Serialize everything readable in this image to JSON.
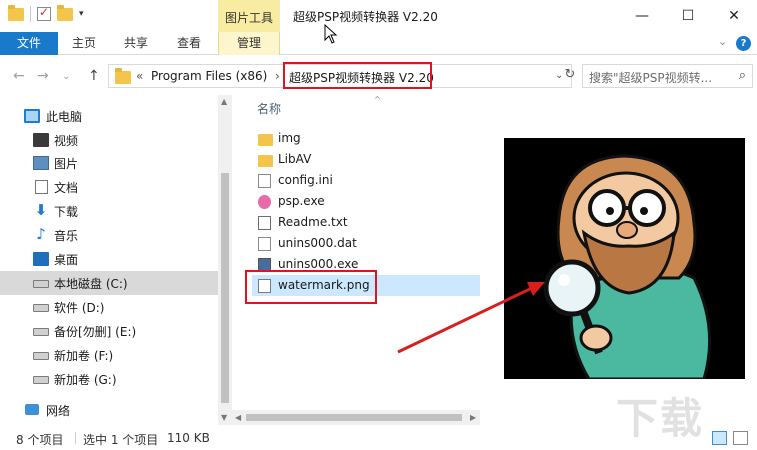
{
  "title_bar": {
    "context_tab": "图片工具",
    "window_title": "超级PSP视频转换器 V2.20",
    "minimize": "—",
    "maximize": "☐",
    "close": "✕"
  },
  "ribbon": {
    "file": "文件",
    "tabs": [
      "主页",
      "共享",
      "查看",
      "管理"
    ],
    "collapse_caret": "⌄",
    "help": "?"
  },
  "address": {
    "prefix": "«",
    "crumbs": [
      "Program Files (x86)",
      "超级PSP视频转换器 V2.20"
    ],
    "separator": "›",
    "dropdown": "⌄",
    "refresh": "↻",
    "search_placeholder": "搜索\"超级PSP视频转...",
    "back": "←",
    "forward": "→",
    "recent": "⌄",
    "up": "↑"
  },
  "sidebar": {
    "items": [
      {
        "label": "此电脑",
        "icon": "computer-icon"
      },
      {
        "label": "视频",
        "icon": "video-icon"
      },
      {
        "label": "图片",
        "icon": "pictures-icon"
      },
      {
        "label": "文档",
        "icon": "documents-icon"
      },
      {
        "label": "下载",
        "icon": "download-icon"
      },
      {
        "label": "音乐",
        "icon": "music-icon"
      },
      {
        "label": "桌面",
        "icon": "desktop-icon"
      },
      {
        "label": "本地磁盘 (C:)",
        "icon": "drive-icon"
      },
      {
        "label": "软件 (D:)",
        "icon": "drive-icon"
      },
      {
        "label": "备份[勿删] (E:)",
        "icon": "drive-icon"
      },
      {
        "label": "新加卷 (F:)",
        "icon": "drive-icon"
      },
      {
        "label": "新加卷 (G:)",
        "icon": "drive-icon"
      },
      {
        "label": "网络",
        "icon": "network-icon"
      }
    ],
    "selected_index": 7
  },
  "file_list": {
    "column_header": "名称",
    "sort_caret": "^",
    "files": [
      {
        "name": "img",
        "icon": "folder-icon"
      },
      {
        "name": "LibAV",
        "icon": "folder-icon"
      },
      {
        "name": "config.ini",
        "icon": "config-file-icon"
      },
      {
        "name": "psp.exe",
        "icon": "exe-icon"
      },
      {
        "name": "Readme.txt",
        "icon": "text-file-icon"
      },
      {
        "name": "unins000.dat",
        "icon": "dat-file-icon"
      },
      {
        "name": "unins000.exe",
        "icon": "installer-icon"
      },
      {
        "name": "watermark.png",
        "icon": "image-file-icon"
      }
    ],
    "selected_index": 7
  },
  "status_bar": {
    "item_count": "8 个项目",
    "selection": "选中 1 个项目",
    "size": "110 KB"
  },
  "colors": {
    "accent_blue": "#1979ca",
    "context_tab_yellow": "#f8eba2",
    "highlight_red": "#e0141e",
    "selection_blue": "#cce8ff"
  }
}
